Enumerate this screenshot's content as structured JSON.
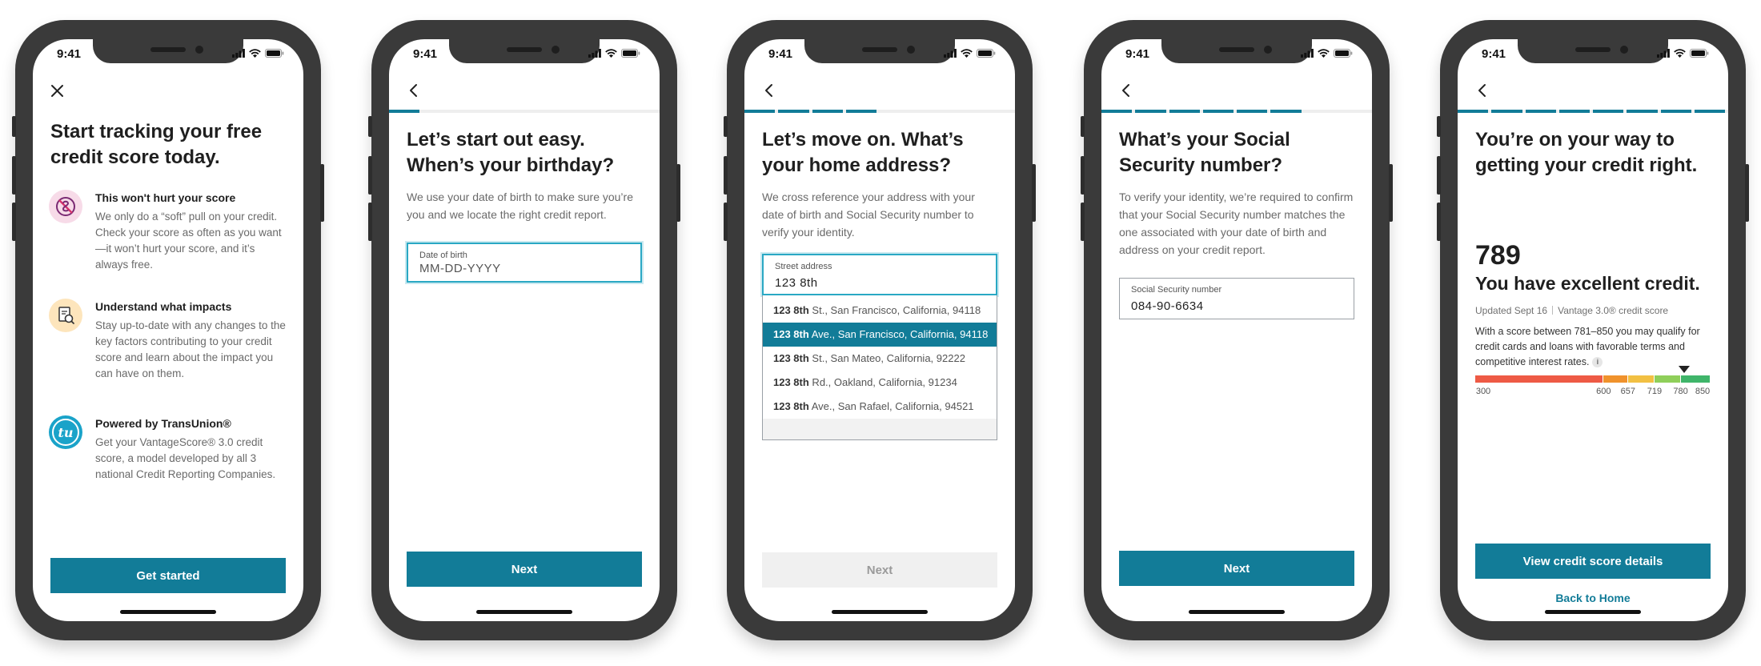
{
  "status_time": "9:41",
  "colors": {
    "brand": "#127c98",
    "focus": "#2aa8c4"
  },
  "screens": [
    {
      "close_icon": "close-icon",
      "title": "Start tracking your free credit score today.",
      "features": [
        {
          "icon": "no-impact-icon",
          "title": "This won't hurt your score",
          "desc": "We only do a “soft” pull on your credit. Check your score as often as you want—it won’t hurt your score, and it’s always free."
        },
        {
          "icon": "document-search-icon",
          "title": "Understand what impacts",
          "desc": "Stay up-to-date with any changes to the key factors contributing to your credit score and learn about the impact you can have on them."
        },
        {
          "icon": "transunion-logo-icon",
          "title": "Powered by TransUnion®",
          "desc": "Get your VantageScore® 3.0 credit score, a model developed by all 3 national Credit Reporting Companies."
        }
      ],
      "logo_text": "tu",
      "cta": "Get started"
    },
    {
      "progress": {
        "filled": 1,
        "total": 8
      },
      "title": "Let’s start out easy. When’s your birthday?",
      "subtitle": "We use your date of birth to make sure you’re you and we locate the right credit report.",
      "field": {
        "label": "Date of birth",
        "placeholder": "MM-DD-YYYY"
      },
      "cta": "Next"
    },
    {
      "progress": {
        "filled": 4,
        "total": 8
      },
      "title": "Let’s move on. What’s your home address?",
      "subtitle": "We cross reference your address with your date of birth and Social Security number to verify your identity.",
      "field": {
        "label": "Street address",
        "value": "123 8th"
      },
      "suggestions": [
        {
          "match": "123 8th",
          "rest": " St., San Francisco, California, 94118",
          "selected": false
        },
        {
          "match": "123 8th",
          "rest": " Ave.,  San Francisco, California, 94118",
          "selected": true
        },
        {
          "match": "123 8th",
          "rest": " St.,  San Mateo, California, 92222",
          "selected": false
        },
        {
          "match": "123 8th",
          "rest": " Rd.,  Oakland, California, 91234",
          "selected": false
        },
        {
          "match": "123 8th",
          "rest": " Ave.,  San Rafael, California, 94521",
          "selected": false
        }
      ],
      "cta": "Next"
    },
    {
      "progress": {
        "filled": 6,
        "total": 8
      },
      "title": "What’s your Social Security number?",
      "subtitle": "To verify your identity, we’re required to confirm that your Social Security number matches the one associated with your date of birth and address on your credit report.",
      "field": {
        "label": "Social Security number",
        "value": "084-90-6634"
      },
      "cta": "Next"
    },
    {
      "progress": {
        "filled": 8,
        "total": 8
      },
      "title": "You’re on your way to getting your credit right.",
      "score": "789",
      "score_label": "You have excellent credit.",
      "updated": "Updated Sept 16",
      "model": "Vantage 3.0® credit score",
      "desc": "With a score between 781–850 you may qualify for credit cards and loans with favorable terms and competitive interest rates.",
      "info_icon": "i",
      "gauge": {
        "min": 300,
        "max": 850,
        "value": 789,
        "bands": [
          {
            "from": 300,
            "to": 600,
            "color": "#ee5a45"
          },
          {
            "from": 600,
            "to": 657,
            "color": "#f0922c"
          },
          {
            "from": 657,
            "to": 719,
            "color": "#f2c043"
          },
          {
            "from": 719,
            "to": 780,
            "color": "#8fcf5a"
          },
          {
            "from": 780,
            "to": 850,
            "color": "#3fb56a"
          }
        ],
        "ticks": [
          "300",
          "600",
          "657",
          "719",
          "780",
          "850"
        ]
      },
      "cta": "View credit score details",
      "link": "Back to Home"
    }
  ]
}
